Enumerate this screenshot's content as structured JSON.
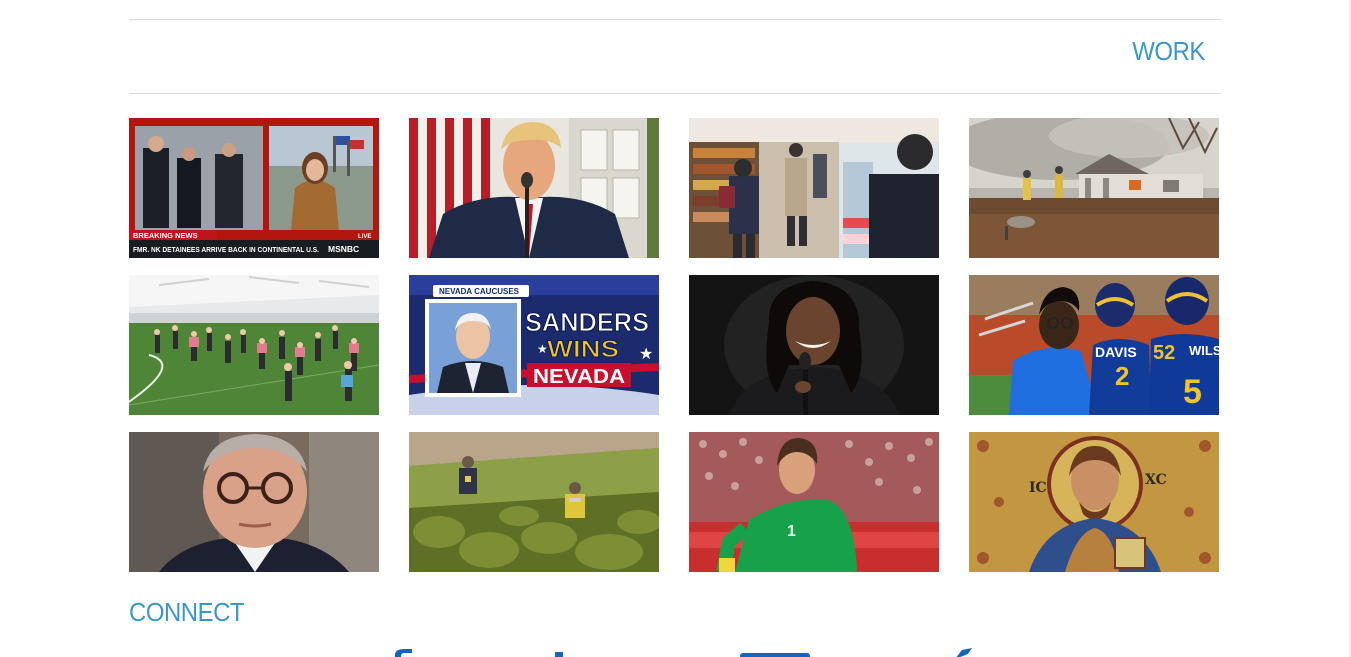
{
  "sections": {
    "work_title": "WORK",
    "connect_title": "CONNECT"
  },
  "colors": {
    "accent": "#3a97c9",
    "rule": "#dcdcdc",
    "social_blue": "#1565c0"
  },
  "work_thumbnails": [
    {
      "name": "msnbc-breaking-news",
      "banner": "BREAKING NEWS",
      "ticker": "FMR. NK DETAINEES ARRIVE BACK IN CONTINENTAL U.S.",
      "network": "MSNBC",
      "live": "LIVE"
    },
    {
      "name": "president-podium"
    },
    {
      "name": "grocery-store-aisle"
    },
    {
      "name": "house-fire-firefighters"
    },
    {
      "name": "indoor-field-fitness-class"
    },
    {
      "name": "sanders-wins-nevada",
      "kicker": "NEVADA CAUCUSES",
      "line1": "SANDERS",
      "line2": "WINS",
      "line3": "NEVADA"
    },
    {
      "name": "speaker-with-microphone"
    },
    {
      "name": "rams-players",
      "jersey1": "DAVIS",
      "number1": "2",
      "jersey2": "WILS",
      "number2": "52"
    },
    {
      "name": "official-portrait-glasses"
    },
    {
      "name": "field-search-team"
    },
    {
      "name": "soccer-goalkeeper",
      "number": "1"
    },
    {
      "name": "byzantine-mosaic",
      "left_letters": "IC",
      "right_letters": "XC"
    }
  ],
  "social_icons": [
    "facebook-icon",
    "instagram-icon",
    "email-icon",
    "twitter-icon"
  ]
}
